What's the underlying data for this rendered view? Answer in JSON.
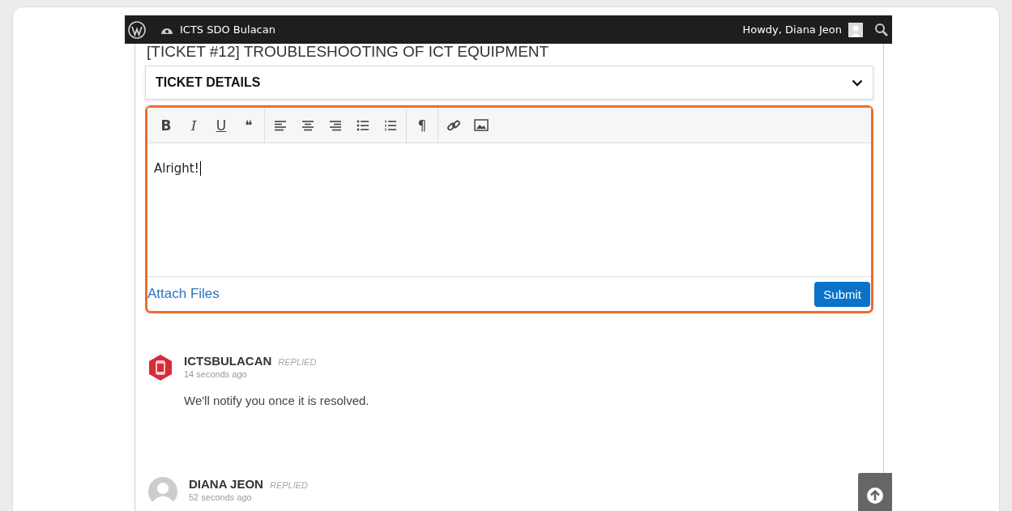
{
  "admin_bar": {
    "site_name": "ICTS SDO Bulacan",
    "greeting": "Howdy, Diana Jeon"
  },
  "ticket": {
    "title": "[TICKET #12] TROUBLESHOOTING OF ICT EQUIPMENT",
    "details_label": "TICKET DETAILS",
    "details_expanded": false
  },
  "editor": {
    "toolbar": [
      {
        "kind": "bold",
        "glyph": "B"
      },
      {
        "kind": "italic",
        "glyph": "I"
      },
      {
        "kind": "underline",
        "glyph": "U"
      },
      {
        "kind": "quote",
        "glyph": "❝"
      },
      {
        "kind": "align-left"
      },
      {
        "kind": "align-center"
      },
      {
        "kind": "align-right"
      },
      {
        "kind": "bullet-list"
      },
      {
        "kind": "numbered-list"
      },
      {
        "kind": "paragraph",
        "glyph": "¶"
      },
      {
        "kind": "link"
      },
      {
        "kind": "image"
      }
    ],
    "value": "Alright!",
    "attach_label": "Attach Files",
    "submit_label": "Submit"
  },
  "replies": [
    {
      "author": "ICTSBULACAN",
      "status": "REPLIED",
      "time": "14 seconds ago",
      "message": "We'll notify you once it is resolved.",
      "kind": "logo"
    },
    {
      "author": "DIANA JEON",
      "status": "REPLIED",
      "time": "52 seconds ago",
      "kind": "default"
    }
  ]
}
